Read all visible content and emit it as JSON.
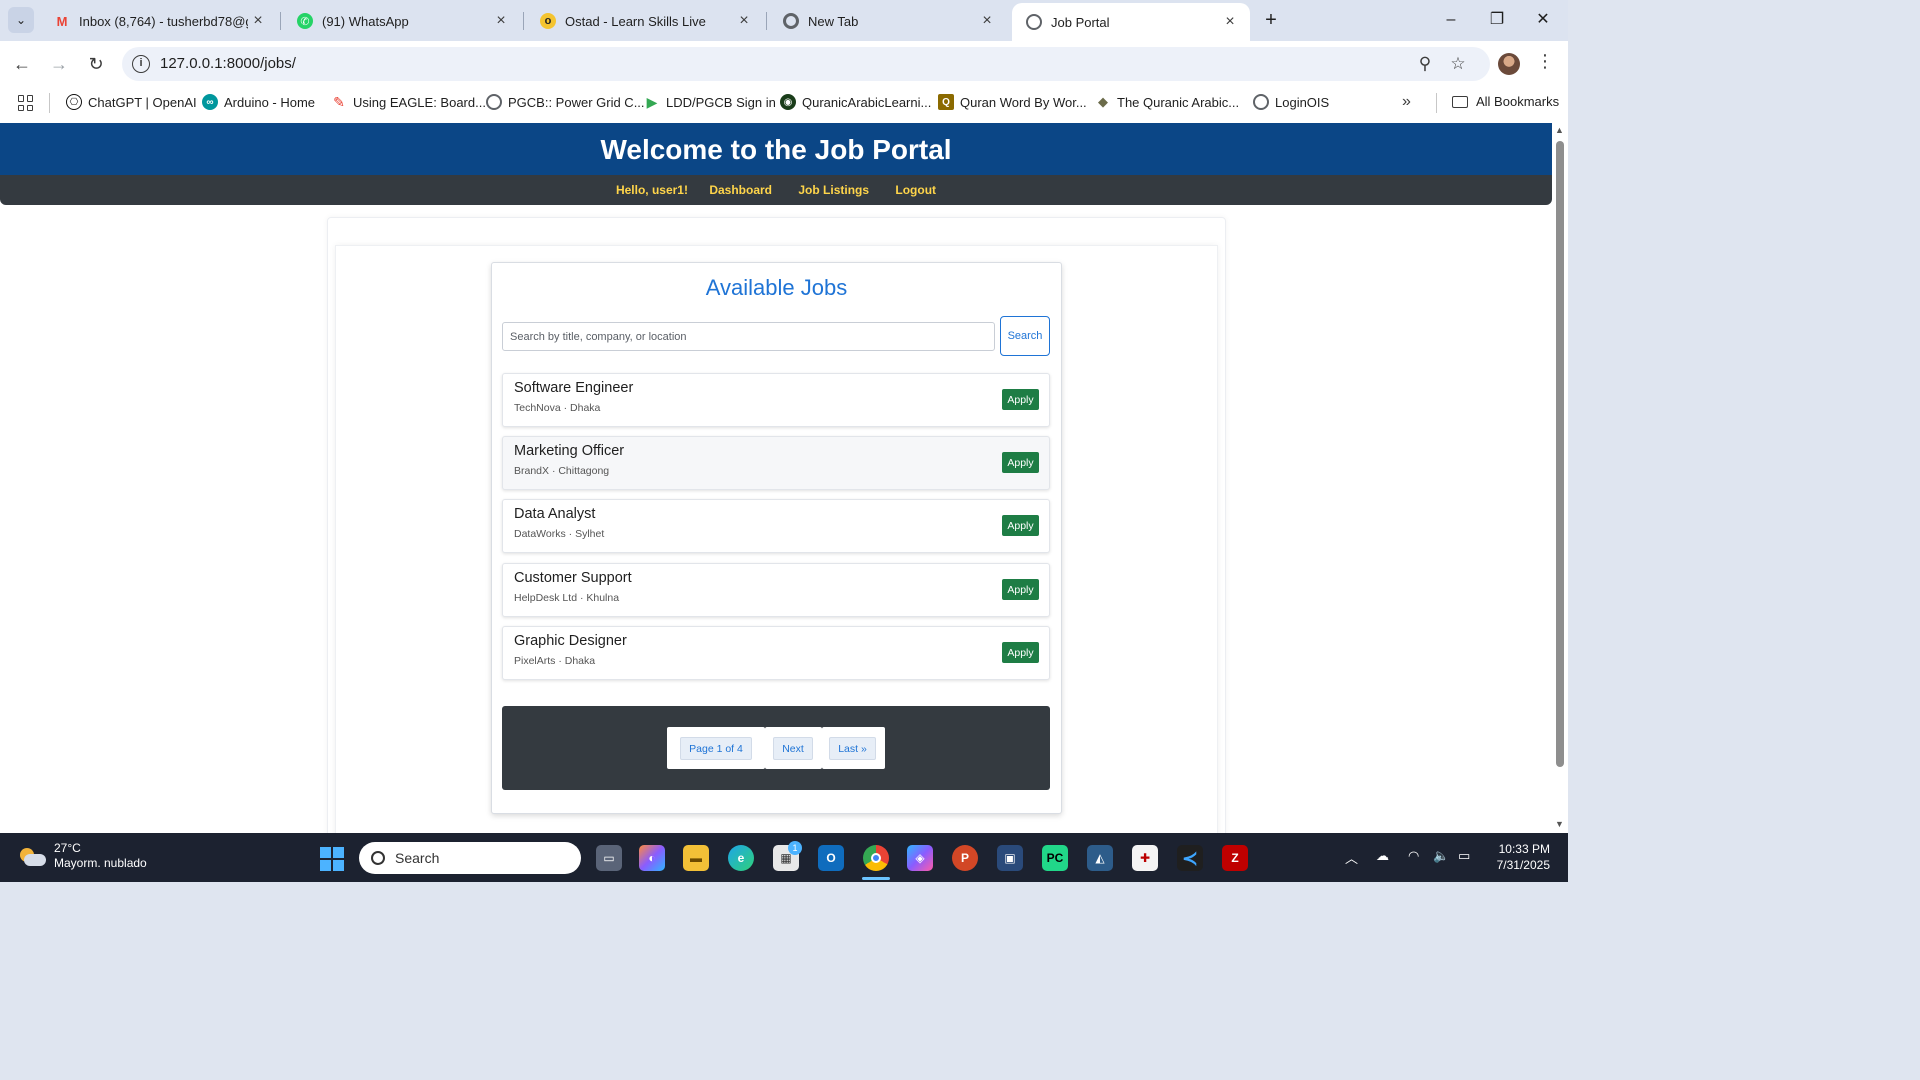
{
  "browser": {
    "tabs": [
      {
        "title": "Inbox (8,764) - tusherbd78@gm",
        "icon": "gmail-icon",
        "color": "#ea4335"
      },
      {
        "title": "(91) WhatsApp",
        "icon": "whatsapp-icon",
        "color": "#25d366"
      },
      {
        "title": "Ostad - Learn Skills Live",
        "icon": "ostad-icon",
        "color": "#f4c430"
      },
      {
        "title": "New Tab",
        "icon": "chrome-icon",
        "color": "#5f6368"
      },
      {
        "title": "Job Portal",
        "icon": "globe-icon",
        "color": "#5f6368",
        "active": true
      }
    ],
    "url": "127.0.0.1:8000/jobs/",
    "bookmarks": [
      {
        "label": "ChatGPT | OpenAI",
        "icon": "openai-icon",
        "color": "#111111"
      },
      {
        "label": "Arduino - Home",
        "icon": "arduino-icon",
        "color": "#00979d"
      },
      {
        "label": "Using EAGLE: Board...",
        "icon": "eagle-icon",
        "color": "#e8392b"
      },
      {
        "label": "PGCB:: Power Grid C...",
        "icon": "globe-icon",
        "color": "#5f6368"
      },
      {
        "label": "LDD/PGCB Sign in",
        "icon": "play-icon",
        "color": "#34a853"
      },
      {
        "label": "QuranicArabicLearni...",
        "icon": "quran-icon",
        "color": "#1a3d1a"
      },
      {
        "label": "Quran Word By Wor...",
        "icon": "q-icon",
        "color": "#8b6a00"
      },
      {
        "label": "The Quranic Arabic...",
        "icon": "book-icon",
        "color": "#6b6b4a"
      },
      {
        "label": "LoginOIS",
        "icon": "globe-icon",
        "color": "#5f6368"
      }
    ],
    "all_bookmarks": "All Bookmarks"
  },
  "site": {
    "header_title": "Welcome to the Job Portal",
    "nav": {
      "greeting": "Hello, user1!",
      "dashboard": "Dashboard",
      "job_listings": "Job Listings",
      "logout": "Logout"
    },
    "jobs_title": "Available Jobs",
    "search": {
      "placeholder": "Search by title, company, or location",
      "button": "Search"
    },
    "jobs": [
      {
        "title": "Software Engineer",
        "subtitle": "TechNova · Dhaka",
        "apply": "Apply"
      },
      {
        "title": "Marketing Officer",
        "subtitle": "BrandX · Chittagong",
        "apply": "Apply"
      },
      {
        "title": "Data Analyst",
        "subtitle": "DataWorks · Sylhet",
        "apply": "Apply"
      },
      {
        "title": "Customer Support",
        "subtitle": "HelpDesk Ltd · Khulna",
        "apply": "Apply"
      },
      {
        "title": "Graphic Designer",
        "subtitle": "PixelArts · Dhaka",
        "apply": "Apply"
      }
    ],
    "pagination": {
      "page_info": "Page 1 of 4",
      "next": "Next",
      "last": "Last »"
    }
  },
  "taskbar": {
    "weather_temp": "27°C",
    "weather_desc": "Mayorm. nublado",
    "search_label": "Search",
    "time": "10:33 PM",
    "date": "7/31/2025",
    "store_badge": "1"
  },
  "colors": {
    "header_bg": "#0b4686",
    "nav_bg": "#343a40",
    "nav_text": "#ffd54a",
    "accent": "#1f74d6",
    "apply_bg": "#1e7d45"
  }
}
